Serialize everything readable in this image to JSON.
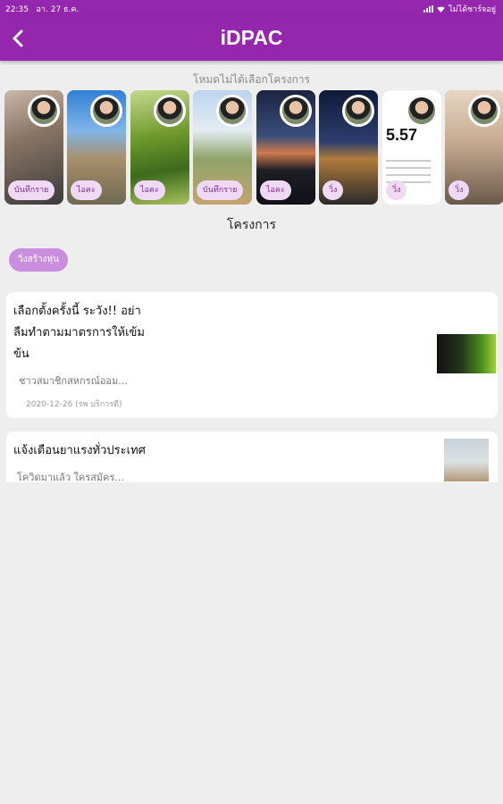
{
  "status_bar": {
    "time": "22:35",
    "date": "อา. 27 ธ.ค.",
    "charging": "ไม่ได้ชาร์จอยู่"
  },
  "header": {
    "title": "iDPAC"
  },
  "stories": {
    "hint": "โหมดไม่ได้เลือกโครงการ",
    "items": [
      {
        "tag": "บันทึกราย"
      },
      {
        "tag": "ไอคะ"
      },
      {
        "tag": "ไอคะ"
      },
      {
        "tag": "บันทึกราย"
      },
      {
        "tag": "ไอคะ"
      },
      {
        "tag": "วิ่ง"
      },
      {
        "tag": "วิ่ง",
        "value": "5.57"
      },
      {
        "tag": "วิ่ง"
      }
    ]
  },
  "projects": {
    "title": "โครงการ",
    "chip": "วิ่งสร้างหุ่น"
  },
  "news": [
    {
      "headline": "เลือกตั้งครั้งนี้ ระวัง!! อย่าลืมทำตามมาตรการให้เข้มข้น",
      "summary": "ชาวสมาชิกสหกรณ์ออม...",
      "meta": "2020-12-26 (รพ บริการดี)"
    },
    {
      "headline": "แจ้งเตือนยาแรงทั่วประเทศ",
      "summary": "โควิดมาแล้ว ใครสมัคร..."
    }
  ]
}
